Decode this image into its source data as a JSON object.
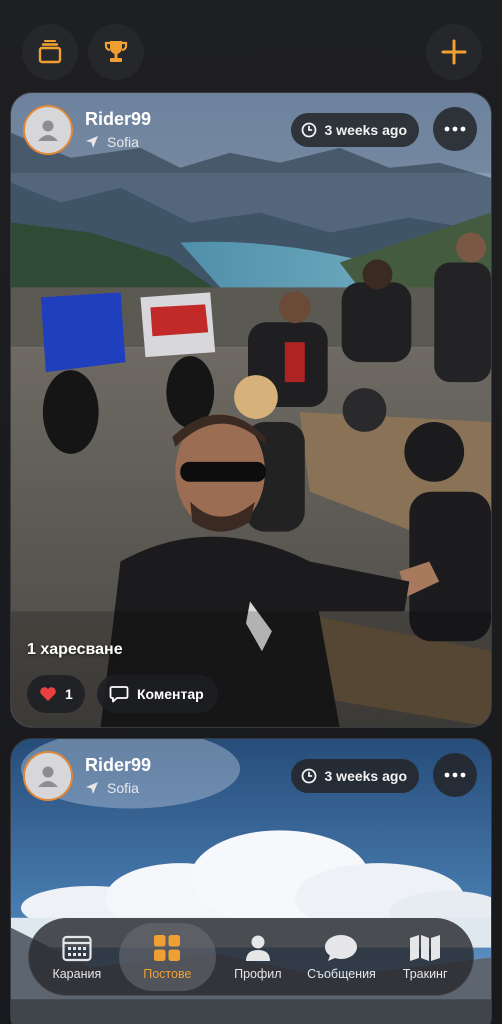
{
  "colors": {
    "accent": "#f0a032",
    "like_red": "#e8403c",
    "background": "#18191c"
  },
  "header": {
    "left_icons": [
      "cards-stack-icon",
      "trophy-icon"
    ],
    "right_icon": "plus-icon"
  },
  "posts": [
    {
      "username": "Rider99",
      "location": "Sofia",
      "time_ago": "3 weeks ago",
      "likes_text": "1 харесване",
      "like_count": "1",
      "comment_label": "Коментар"
    },
    {
      "username": "Rider99",
      "location": "Sofia",
      "time_ago": "3 weeks ago"
    }
  ],
  "nav": {
    "items": [
      {
        "label": "Карания",
        "icon": "calendar-icon"
      },
      {
        "label": "Постове",
        "icon": "grid-icon",
        "active": true
      },
      {
        "label": "Профил",
        "icon": "person-icon"
      },
      {
        "label": "Съобщения",
        "icon": "chat-bubble-icon"
      },
      {
        "label": "Тракинг",
        "icon": "map-icon"
      }
    ]
  }
}
